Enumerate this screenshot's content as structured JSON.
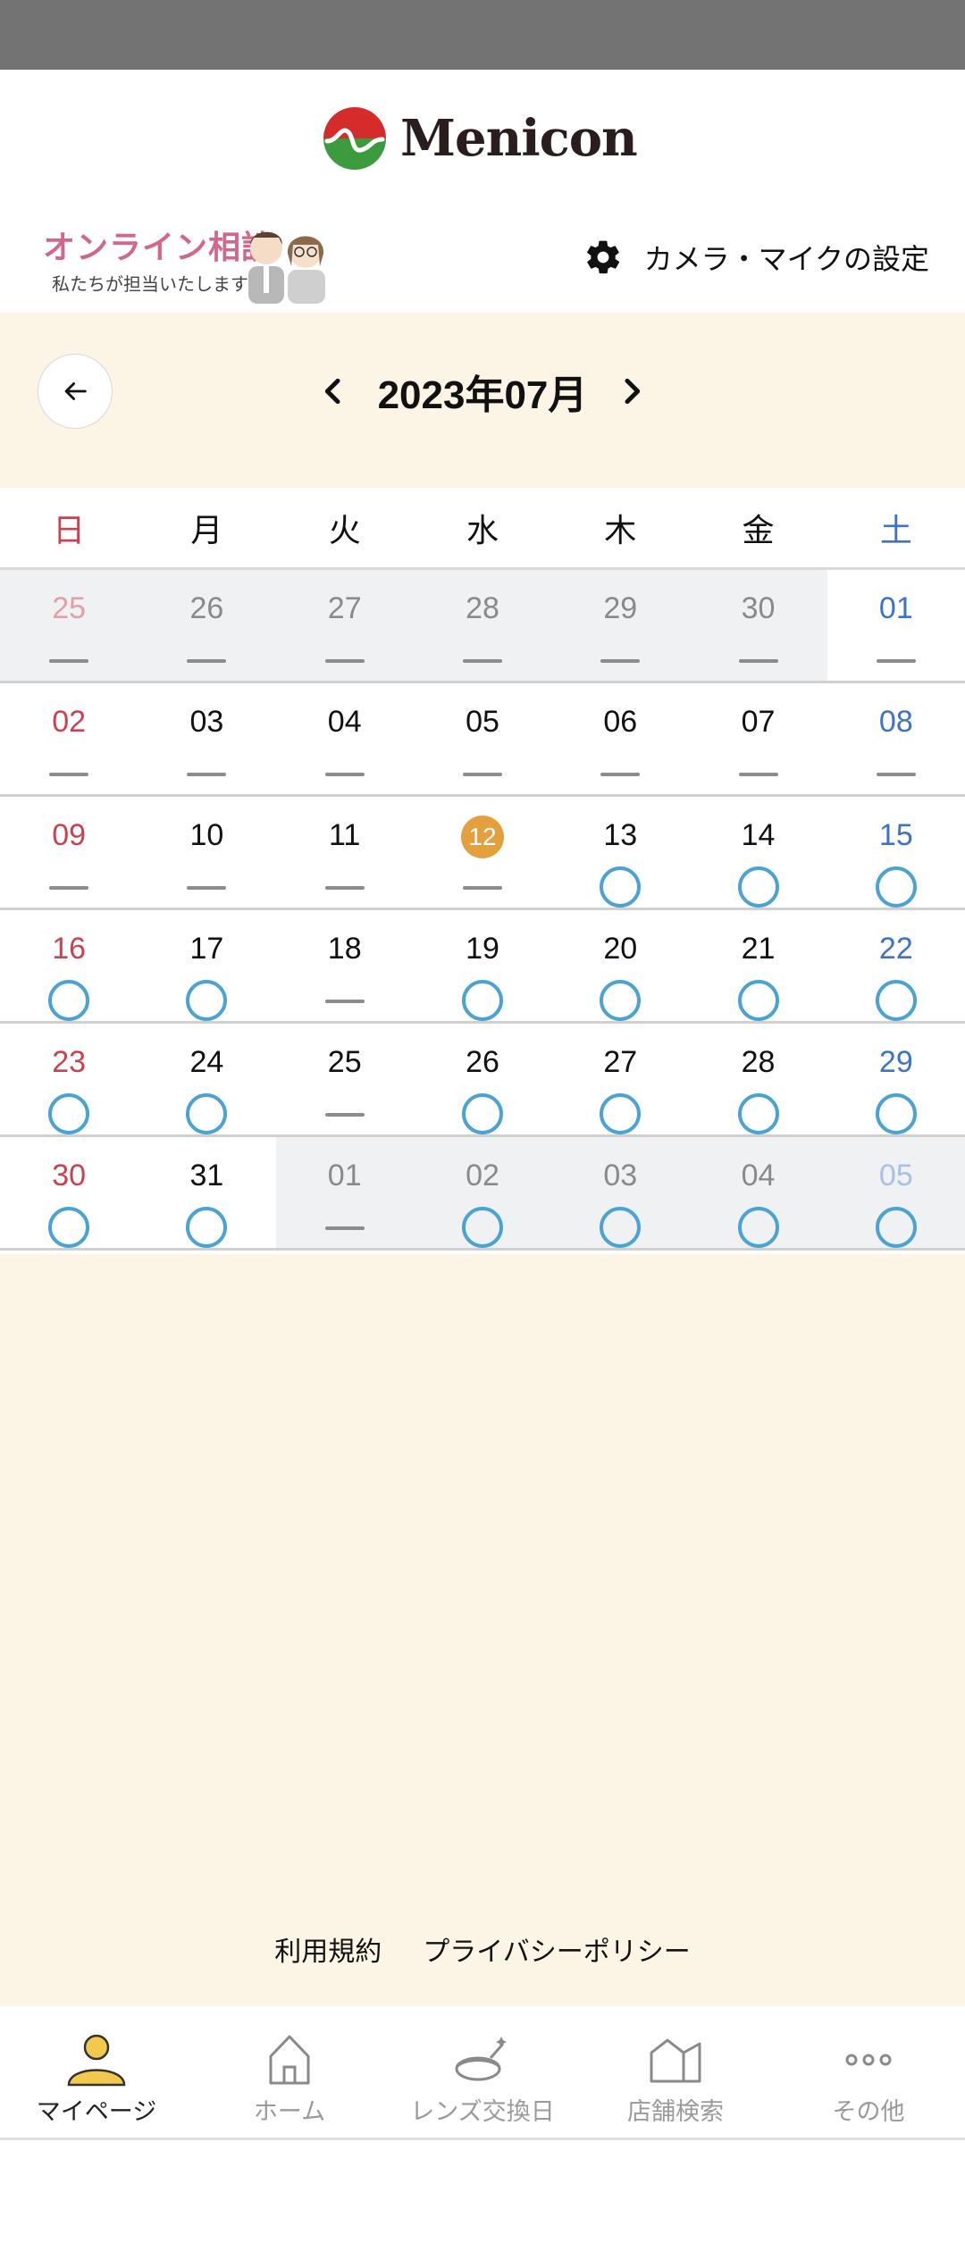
{
  "brand": {
    "name": "Menicon",
    "colors": {
      "red": "#d52b2b",
      "green": "#3c9b3c",
      "accent": "#e5a03e",
      "circle": "#4aa3d3",
      "background": "#fcf5e6"
    }
  },
  "subheader": {
    "online_title": "オンライン相談",
    "online_subtitle": "私たちが担当いたします",
    "settings_label": "カメラ・マイクの設定",
    "settings_icon": "gear-icon"
  },
  "calendar": {
    "month_label": "2023年07月",
    "prev_icon": "chevron-left-icon",
    "next_icon": "chevron-right-icon",
    "back_icon": "arrow-left-icon",
    "weekdays": [
      "日",
      "月",
      "火",
      "水",
      "木",
      "金",
      "土"
    ],
    "weeks": [
      [
        {
          "d": "25",
          "other": true,
          "mark": "dash"
        },
        {
          "d": "26",
          "other": true,
          "mark": "dash"
        },
        {
          "d": "27",
          "other": true,
          "mark": "dash"
        },
        {
          "d": "28",
          "other": true,
          "mark": "dash"
        },
        {
          "d": "29",
          "other": true,
          "mark": "dash"
        },
        {
          "d": "30",
          "other": true,
          "mark": "dash"
        },
        {
          "d": "01",
          "other": false,
          "mark": "dash"
        }
      ],
      [
        {
          "d": "02",
          "other": false,
          "mark": "dash"
        },
        {
          "d": "03",
          "other": false,
          "mark": "dash"
        },
        {
          "d": "04",
          "other": false,
          "mark": "dash"
        },
        {
          "d": "05",
          "other": false,
          "mark": "dash"
        },
        {
          "d": "06",
          "other": false,
          "mark": "dash"
        },
        {
          "d": "07",
          "other": false,
          "mark": "dash"
        },
        {
          "d": "08",
          "other": false,
          "mark": "dash"
        }
      ],
      [
        {
          "d": "09",
          "other": false,
          "mark": "dash"
        },
        {
          "d": "10",
          "other": false,
          "mark": "dash"
        },
        {
          "d": "11",
          "other": false,
          "mark": "dash"
        },
        {
          "d": "12",
          "other": false,
          "mark": "dash",
          "today": true
        },
        {
          "d": "13",
          "other": false,
          "mark": "circle"
        },
        {
          "d": "14",
          "other": false,
          "mark": "circle"
        },
        {
          "d": "15",
          "other": false,
          "mark": "circle"
        }
      ],
      [
        {
          "d": "16",
          "other": false,
          "mark": "circle"
        },
        {
          "d": "17",
          "other": false,
          "mark": "circle"
        },
        {
          "d": "18",
          "other": false,
          "mark": "dash"
        },
        {
          "d": "19",
          "other": false,
          "mark": "circle"
        },
        {
          "d": "20",
          "other": false,
          "mark": "circle"
        },
        {
          "d": "21",
          "other": false,
          "mark": "circle"
        },
        {
          "d": "22",
          "other": false,
          "mark": "circle"
        }
      ],
      [
        {
          "d": "23",
          "other": false,
          "mark": "circle"
        },
        {
          "d": "24",
          "other": false,
          "mark": "circle"
        },
        {
          "d": "25",
          "other": false,
          "mark": "dash"
        },
        {
          "d": "26",
          "other": false,
          "mark": "circle"
        },
        {
          "d": "27",
          "other": false,
          "mark": "circle"
        },
        {
          "d": "28",
          "other": false,
          "mark": "circle"
        },
        {
          "d": "29",
          "other": false,
          "mark": "circle"
        }
      ],
      [
        {
          "d": "30",
          "other": false,
          "mark": "circle"
        },
        {
          "d": "31",
          "other": false,
          "mark": "circle"
        },
        {
          "d": "01",
          "other": true,
          "mark": "dash"
        },
        {
          "d": "02",
          "other": true,
          "mark": "circle"
        },
        {
          "d": "03",
          "other": true,
          "mark": "circle"
        },
        {
          "d": "04",
          "other": true,
          "mark": "circle"
        },
        {
          "d": "05",
          "other": true,
          "mark": "circle"
        }
      ]
    ]
  },
  "footer": {
    "terms": "利用規約",
    "privacy": "プライバシーポリシー"
  },
  "tabs": [
    {
      "label": "マイページ",
      "icon": "person-icon",
      "active": true
    },
    {
      "label": "ホーム",
      "icon": "house-icon",
      "active": false
    },
    {
      "label": "レンズ交換日",
      "icon": "lens-case-icon",
      "active": false
    },
    {
      "label": "店舗検索",
      "icon": "store-icon",
      "active": false
    },
    {
      "label": "その他",
      "icon": "more-icon",
      "active": false
    }
  ]
}
